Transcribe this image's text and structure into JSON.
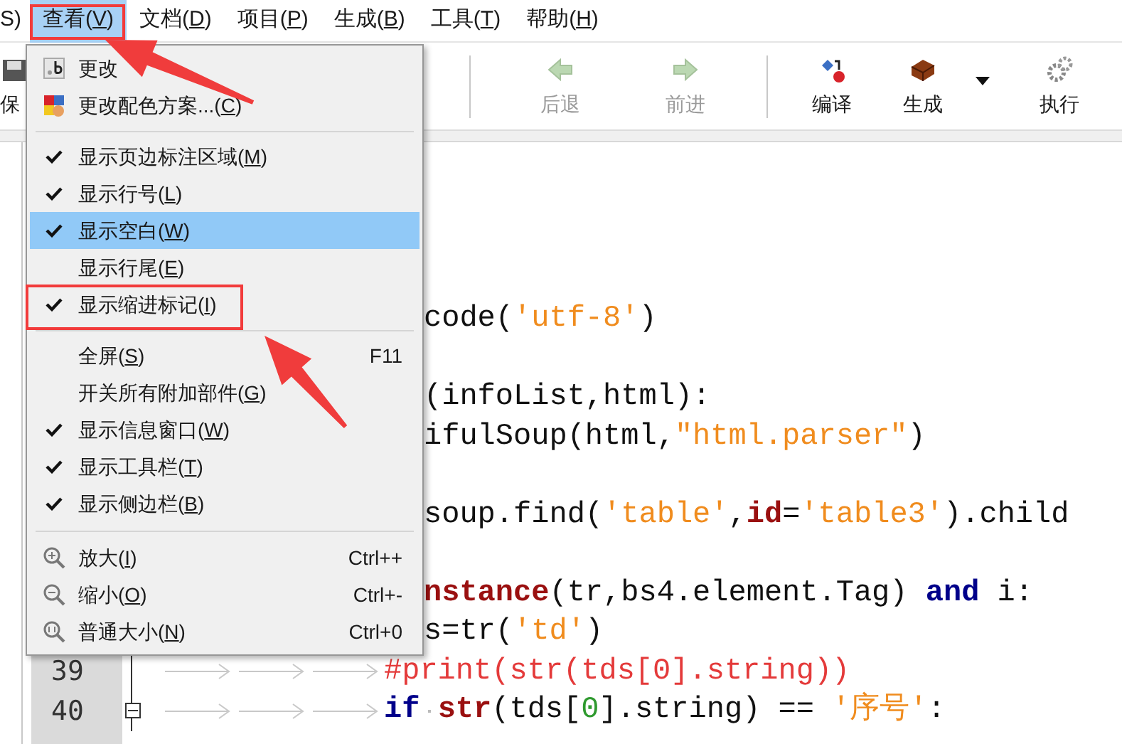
{
  "menubar": [
    {
      "label": "S)",
      "selected": false,
      "annotated": false
    },
    {
      "label": "查看(V)",
      "selected": true,
      "annotated": true
    },
    {
      "label": "文档(D)",
      "selected": false,
      "annotated": false
    },
    {
      "label": "项目(P)",
      "selected": false,
      "annotated": false
    },
    {
      "label": "生成(B)",
      "selected": false,
      "annotated": false
    },
    {
      "label": "工具(T)",
      "selected": false,
      "annotated": false
    },
    {
      "label": "帮助(H)",
      "selected": false,
      "annotated": false
    }
  ],
  "toolbar": [
    {
      "kind": "partial",
      "label": "保",
      "disabled": false
    },
    {
      "kind": "spacer"
    },
    {
      "kind": "separator"
    },
    {
      "kind": "back",
      "label": "后退",
      "disabled": true
    },
    {
      "kind": "forward",
      "label": "前进",
      "disabled": true
    },
    {
      "kind": "separator"
    },
    {
      "kind": "compile",
      "label": "编译",
      "disabled": false
    },
    {
      "kind": "build",
      "label": "生成",
      "disabled": false
    },
    {
      "kind": "dropdown"
    },
    {
      "kind": "run",
      "label": "执行",
      "disabled": false
    }
  ],
  "view_menu": [
    {
      "kind": "icon",
      "label": "更改",
      "selected": false,
      "annotated": false
    },
    {
      "kind": "icon",
      "label": "更改配色方案...(C)",
      "selected": false,
      "annotated": false
    },
    {
      "kind": "separator"
    },
    {
      "kind": "check",
      "label": "显示页边标注区域(M)",
      "checked": true,
      "selected": false,
      "annotated": false
    },
    {
      "kind": "check",
      "label": "显示行号(L)",
      "checked": true,
      "selected": false,
      "annotated": false
    },
    {
      "kind": "check",
      "label": "显示空白(W)",
      "checked": true,
      "selected": true,
      "annotated": false
    },
    {
      "kind": "check",
      "label": "显示行尾(E)",
      "checked": false,
      "selected": false,
      "annotated": false
    },
    {
      "kind": "check",
      "label": "显示缩进标记(I)",
      "checked": true,
      "selected": false,
      "annotated": true
    },
    {
      "kind": "separator"
    },
    {
      "kind": "check",
      "label": "全屏(S)",
      "shortcut": "F11",
      "checked": false,
      "selected": false,
      "annotated": false
    },
    {
      "kind": "check",
      "label": "开关所有附加部件(G)",
      "checked": false,
      "selected": false,
      "annotated": false
    },
    {
      "kind": "check",
      "label": "显示信息窗口(W)",
      "checked": true,
      "selected": false,
      "annotated": false
    },
    {
      "kind": "check",
      "label": "显示工具栏(T)",
      "checked": true,
      "selected": false,
      "annotated": false
    },
    {
      "kind": "check",
      "label": "显示侧边栏(B)",
      "checked": true,
      "selected": false,
      "annotated": false
    },
    {
      "kind": "separator"
    },
    {
      "kind": "icon",
      "label": "放大(I)",
      "shortcut": "Ctrl++",
      "selected": false,
      "annotated": false
    },
    {
      "kind": "icon",
      "label": "缩小(O)",
      "shortcut": "Ctrl+-",
      "selected": false,
      "annotated": false
    },
    {
      "kind": "icon",
      "label": "普通大小(N)",
      "shortcut": "Ctrl+0",
      "selected": false,
      "annotated": false
    }
  ],
  "editor": {
    "lines": [
      {
        "clipped": true,
        "tokens": [
          {
            "kind": "plain",
            "text": "code("
          },
          {
            "kind": "string",
            "text": "'utf-8'"
          },
          {
            "kind": "plain",
            "text": ")"
          }
        ]
      },
      {
        "clipped": true,
        "blank_before": true,
        "tokens": [
          {
            "kind": "plain",
            "text": "(infoList,html):"
          }
        ]
      },
      {
        "clipped": true,
        "tokens": [
          {
            "kind": "plain",
            "text": "ifulSoup(html,"
          },
          {
            "kind": "string",
            "text": "\"html.parser\""
          },
          {
            "kind": "plain",
            "text": ")"
          }
        ]
      },
      {
        "clipped": true,
        "blank_before": true,
        "tokens": [
          {
            "kind": "plain",
            "text": "soup.find("
          },
          {
            "kind": "string",
            "text": "'table'"
          },
          {
            "kind": "plain",
            "text": ","
          },
          {
            "kind": "builtin",
            "text": "id"
          },
          {
            "kind": "plain",
            "text": "="
          },
          {
            "kind": "string",
            "text": "'table3'"
          },
          {
            "kind": "plain",
            "text": ").child"
          }
        ]
      },
      {
        "clipped": true,
        "blank_before": true,
        "tokens": [
          {
            "kind": "builtin",
            "text": "nstance"
          },
          {
            "kind": "plain",
            "text": "(tr,bs4.element.Tag) "
          },
          {
            "kind": "keyword",
            "text": "and"
          },
          {
            "kind": "plain",
            "text": " i:"
          }
        ]
      },
      {
        "clipped": true,
        "tokens": [
          {
            "kind": "plain",
            "text": "s=tr("
          },
          {
            "kind": "string",
            "text": "'td'"
          },
          {
            "kind": "plain",
            "text": ")"
          }
        ]
      },
      {
        "number": "39",
        "clipped": false,
        "tokens": [
          {
            "kind": "tab"
          },
          {
            "kind": "tab"
          },
          {
            "kind": "tab"
          },
          {
            "kind": "comment",
            "text": "#print(str(tds[0].string))"
          }
        ]
      },
      {
        "number": "40",
        "clipped": false,
        "fold_expanded": true,
        "tokens": [
          {
            "kind": "tab"
          },
          {
            "kind": "tab"
          },
          {
            "kind": "tab"
          },
          {
            "kind": "keyword",
            "text": "if"
          },
          {
            "kind": "space"
          },
          {
            "kind": "builtin",
            "text": "str"
          },
          {
            "kind": "plain",
            "text": "(tds["
          },
          {
            "kind": "number",
            "text": "0"
          },
          {
            "kind": "plain",
            "text": "].string) == "
          },
          {
            "kind": "string",
            "text": "'序号'"
          },
          {
            "kind": "plain",
            "text": ":"
          }
        ]
      }
    ]
  }
}
